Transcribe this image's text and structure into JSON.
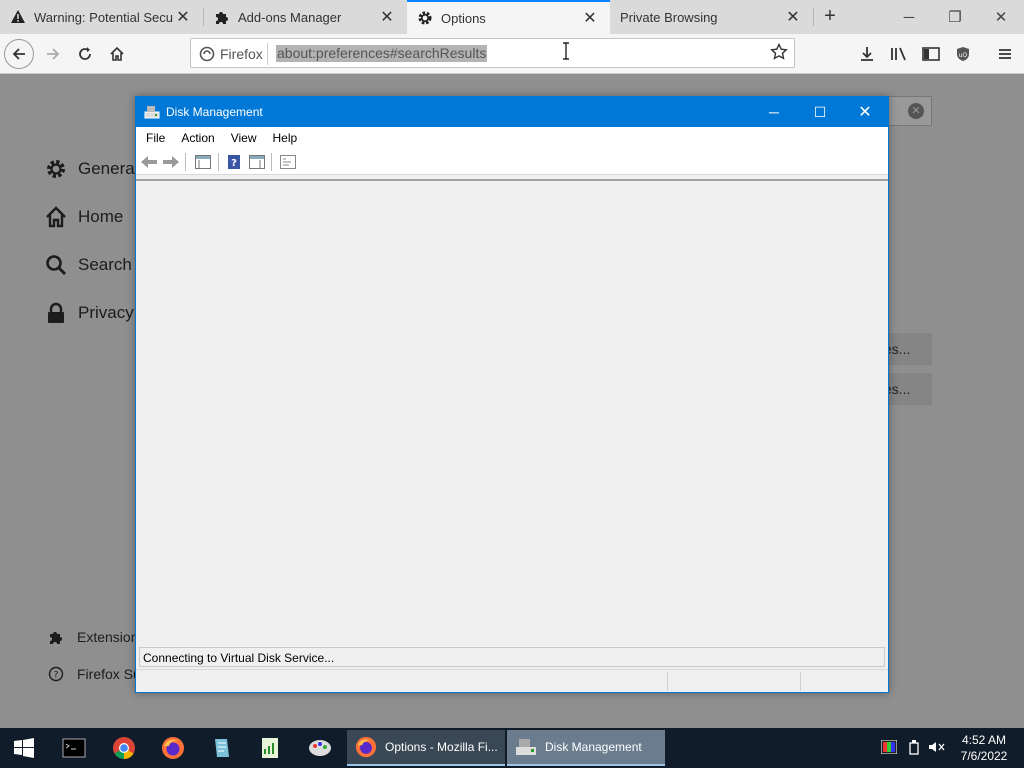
{
  "browser": {
    "tabs": [
      {
        "label": "Warning: Potential Security Risk Ahead",
        "icon": "warning-icon",
        "active": false
      },
      {
        "label": "Add-ons Manager",
        "icon": "puzzle-icon",
        "active": false
      },
      {
        "label": "Options",
        "icon": "gear-icon",
        "active": true
      },
      {
        "label": "Private Browsing",
        "icon": "none",
        "active": false
      }
    ],
    "identity_label": "Firefox",
    "url": "about:preferences#searchResults"
  },
  "settings_page": {
    "nav": [
      {
        "label": "General",
        "icon": "gear-icon"
      },
      {
        "label": "Home",
        "icon": "home-icon"
      },
      {
        "label": "Search",
        "icon": "search-icon"
      },
      {
        "label": "Privacy &",
        "icon": "lock-icon"
      }
    ],
    "bottom_links": [
      {
        "label": "Extension",
        "icon": "puzzle-icon"
      },
      {
        "label": "Firefox Su",
        "icon": "help-icon"
      }
    ],
    "right_buttons": [
      "tes...",
      "tes..."
    ]
  },
  "disk_management": {
    "title": "Disk Management",
    "menus": [
      "File",
      "Action",
      "View",
      "Help"
    ],
    "status": "Connecting to Virtual Disk Service...",
    "accent": "#0078d7"
  },
  "taskbar": {
    "tasks": [
      {
        "label": "Options - Mozilla Fi...",
        "icon": "firefox-icon"
      },
      {
        "label": "Disk Management",
        "icon": "disk-management-icon"
      }
    ],
    "clock_time": "4:52 AM",
    "clock_date": "7/6/2022"
  }
}
